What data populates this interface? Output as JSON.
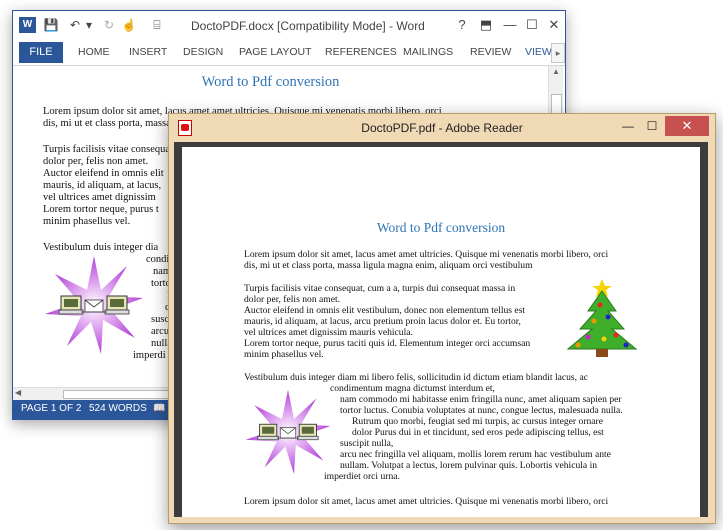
{
  "word": {
    "icon_letter": "W",
    "title": "DoctoPDF.docx [Compatibility Mode] - Word",
    "controls": {
      "help": "?",
      "ribbon_display": "⬒",
      "minimize": "—",
      "maximize": "☐",
      "close": "✕"
    },
    "quick_access": {
      "save": "💾",
      "undo": "↶",
      "undo_dropdown": "▾",
      "redo": "↻",
      "touch": "☝",
      "customize": "⌸"
    },
    "tabs": {
      "file": "FILE",
      "home": "HOME",
      "insert": "INSERT",
      "design": "DESIGN",
      "page_layout": "PAGE LAYOUT",
      "references": "REFERENCES",
      "mailings": "MAILINGS",
      "review": "REVIEW",
      "view": "VIEW",
      "scroll_right": "▸"
    },
    "document": {
      "heading": "Word to Pdf conversion",
      "lines": [
        "Lorem ipsum dolor sit amet, lacus amet amet ultricies. Quisque mi venenatis morbi libero, orci",
        "dis, mi ut et class porta, massa ligula magna enim, aliquam orci vestibulum.",
        "Turpis facilisis vitae consequat,",
        "dolor per, felis non amet.",
        "Auctor eleifend in omnis elit",
        "mauris, id aliquam, at lacus,",
        "vel ultrices amet dignissim",
        "Lorem tortor neque, purus t",
        "minim phasellus vel.",
        "Vestibulum duis integer dia",
        "condi",
        "nam",
        "torto",
        "R",
        "d",
        "susc",
        "arcu",
        "nulla",
        "imperdi"
      ]
    },
    "status": {
      "page": "PAGE 1 OF 2",
      "words": "524 WORDS",
      "proof": "📖"
    }
  },
  "reader": {
    "title": "DoctoPDF.pdf - Adobe Reader",
    "controls": {
      "minimize": "—",
      "maximize": "☐",
      "close": "✕"
    },
    "document": {
      "heading": "Word to Pdf conversion",
      "lines": [
        "Lorem ipsum dolor sit amet, lacus amet amet ultricies. Quisque mi venenatis morbi libero, orci",
        "dis, mi ut et class porta, massa ligula magna enim, aliquam orci vestibulum",
        "Turpis facilisis vitae consequat, cum a a, turpis dui consequat massa in",
        "dolor per, felis non amet.",
        "Auctor eleifend in omnis elit vestibulum, donec non elementum tellus est",
        "mauris, id aliquam, at lacus, arcu pretium proin lacus dolor et. Eu tortor,",
        "vel ultrices amet dignissim mauris vehicula.",
        "Lorem tortor neque, purus taciti quis id. Elementum integer orci accumsan",
        "minim phasellus vel.",
        "Vestibulum duis integer diam mi libero felis, sollicitudin id dictum etiam blandit lacus, ac",
        "condimentum magna dictumst interdum et,",
        "nam commodo mi habitasse enim fringilla nunc, amet aliquam sapien per",
        "tortor luctus. Conubia voluptates at nunc, congue lectus, malesuada nulla.",
        "Rutrum quo morbi, feugiat sed mi turpis, ac cursus integer ornare",
        "dolor Purus dui in et tincidunt, sed eros pede adipiscing tellus, est",
        "suscipit nulla,",
        "arcu nec fringilla vel aliquam, mollis lorem rerum hac vestibulum ante",
        "nullam. Volutpat a lectus, lorem pulvinar quis. Lobortis vehicula in",
        "imperdiet orci urna.",
        "Lorem ipsum dolor sit amet, lacus amet amet ultricies. Quisque mi venenatis morbi libero, orci"
      ]
    }
  },
  "colors": {
    "word_brand": "#2b579a",
    "heading_blue": "#2e74b5",
    "reader_frame": "#f0d9b5",
    "reader_close": "#c75050"
  }
}
